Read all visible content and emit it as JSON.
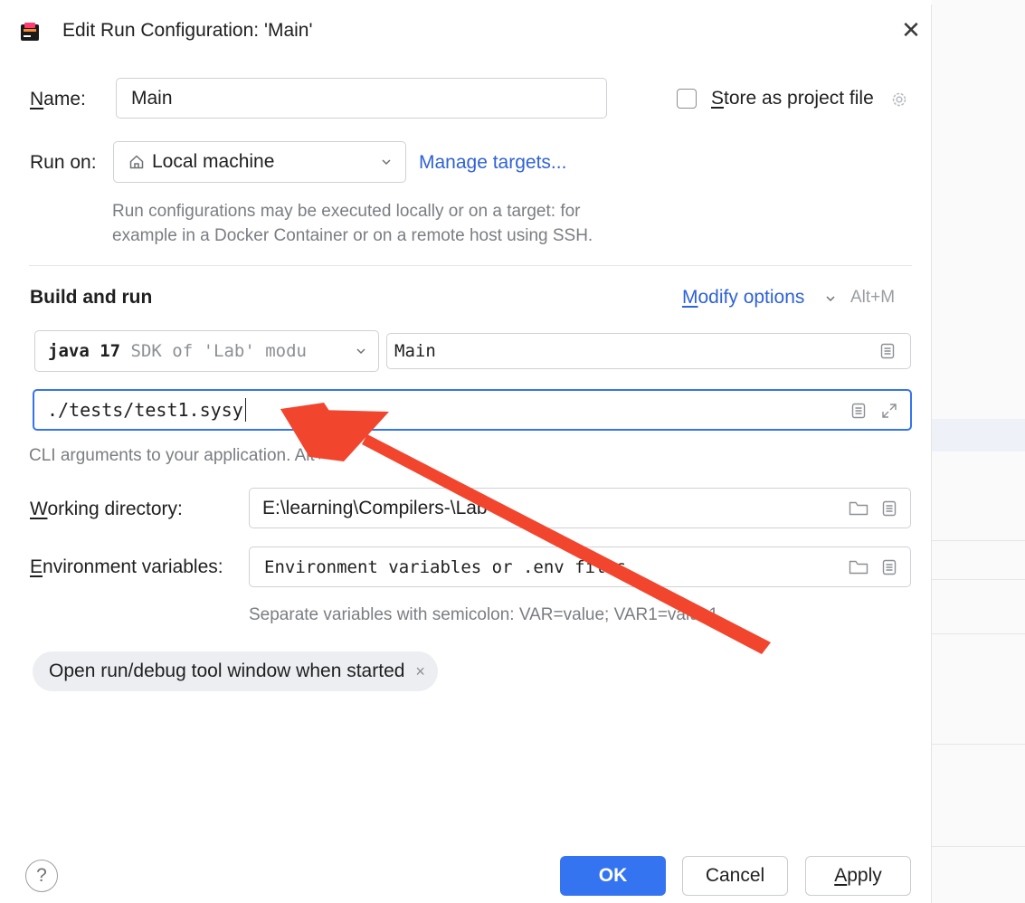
{
  "dialog": {
    "title": "Edit Run Configuration: 'Main'",
    "close_symbol": "✕"
  },
  "name": {
    "label": "Name:",
    "value": "Main"
  },
  "store_as_project": {
    "label": "Store as project file",
    "checked": false
  },
  "run_on": {
    "label": "Run on:",
    "value": "Local machine",
    "manage_targets": "Manage targets...",
    "hint_line1": "Run configurations may be executed locally or on a target: for",
    "hint_line2": "example in a Docker Container or on a remote host using SSH."
  },
  "build_and_run": {
    "title": "Build and run",
    "modify_options": "Modify options",
    "modify_shortcut": "Alt+M",
    "sdk_bold": "java 17",
    "sdk_rest": " SDK of 'Lab' modu",
    "main_class": "Main",
    "program_args": "./tests/test1.sysy",
    "args_hint": "CLI arguments to your application. Alt+"
  },
  "working_directory": {
    "label": "Working directory:",
    "value": "E:\\learning\\Compilers-\\Lab"
  },
  "environment_variables": {
    "label": "Environment variables:",
    "placeholder": "Environment variables or .env files",
    "hint": "Separate variables with semicolon: VAR=value; VAR1=value1"
  },
  "chip": {
    "label": "Open run/debug tool window when started",
    "remove_symbol": "×"
  },
  "footer": {
    "help_symbol": "?",
    "ok": "OK",
    "cancel": "Cancel",
    "apply": "Apply"
  },
  "colors": {
    "accent": "#3574f0",
    "link": "#2f62d6",
    "annotation_arrow": "#f2452e"
  },
  "icons": {
    "app": "intellij-app-icon",
    "home": "home-icon",
    "settings": "gear-icon",
    "dropdown": "chevron-down-icon",
    "expand": "expand-icon",
    "folder": "folder-icon",
    "list": "list-icon"
  }
}
